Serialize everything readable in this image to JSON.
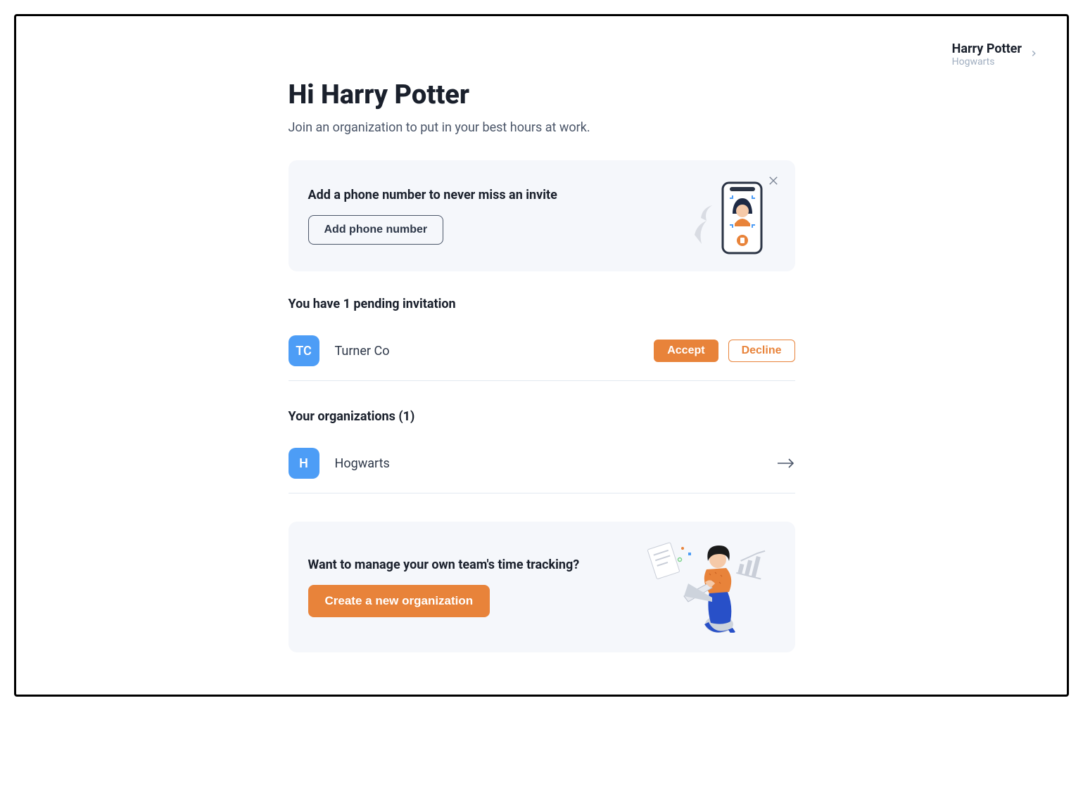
{
  "header": {
    "user_name": "Harry Potter",
    "user_org": "Hogwarts"
  },
  "main": {
    "greeting": "Hi Harry Potter",
    "subtitle": "Join an organization to put in your best hours at work.",
    "phone_prompt": {
      "title": "Add a phone number to never miss an invite",
      "button_label": "Add phone number"
    },
    "pending": {
      "heading": "You have 1 pending invitation",
      "items": [
        {
          "initials": "TC",
          "name": "Turner Co",
          "accept_label": "Accept",
          "decline_label": "Decline"
        }
      ]
    },
    "orgs": {
      "heading": "Your organizations (1)",
      "items": [
        {
          "initials": "H",
          "name": "Hogwarts"
        }
      ]
    },
    "create_org": {
      "title": "Want to manage your own team's time tracking?",
      "button_label": "Create a new organization"
    }
  }
}
